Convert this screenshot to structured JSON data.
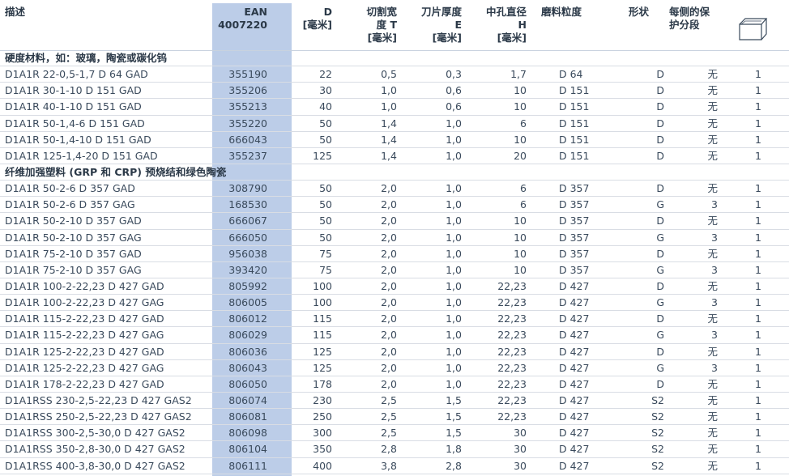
{
  "columns": {
    "desc": "描述",
    "ean": "EAN\n4007220",
    "d": "D\n[毫米]",
    "t": "切割宽\n度 T\n[毫米]",
    "e": "刀片厚度\nE\n[毫米]",
    "h": "中孔直径\nH\n[毫米]",
    "grit": "磨料粒度",
    "shape": "形状",
    "protect": "每侧的保\n护分段",
    "pack_icon": "box-icon"
  },
  "sections": [
    {
      "title": "硬度材料，如：玻璃，陶瓷或碳化钨",
      "rows": [
        {
          "desc": "D1A1R 22-0,5-1,7 D 64 GAD",
          "ean": "355190",
          "d": "22",
          "t": "0,5",
          "e": "0,3",
          "h": "1,7",
          "grit": "D 64",
          "shape": "D",
          "protect": "无",
          "pack": "1"
        },
        {
          "desc": "D1A1R 30-1-10 D 151 GAD",
          "ean": "355206",
          "d": "30",
          "t": "1,0",
          "e": "0,6",
          "h": "10",
          "grit": "D 151",
          "shape": "D",
          "protect": "无",
          "pack": "1"
        },
        {
          "desc": "D1A1R 40-1-10 D 151 GAD",
          "ean": "355213",
          "d": "40",
          "t": "1,0",
          "e": "0,6",
          "h": "10",
          "grit": "D 151",
          "shape": "D",
          "protect": "无",
          "pack": "1"
        },
        {
          "desc": "D1A1R 50-1,4-6 D 151 GAD",
          "ean": "355220",
          "d": "50",
          "t": "1,4",
          "e": "1,0",
          "h": "6",
          "grit": "D 151",
          "shape": "D",
          "protect": "无",
          "pack": "1"
        },
        {
          "desc": "D1A1R 50-1,4-10 D 151 GAD",
          "ean": "666043",
          "d": "50",
          "t": "1,4",
          "e": "1,0",
          "h": "10",
          "grit": "D 151",
          "shape": "D",
          "protect": "无",
          "pack": "1"
        },
        {
          "desc": "D1A1R 125-1,4-20 D 151 GAD",
          "ean": "355237",
          "d": "125",
          "t": "1,4",
          "e": "1,0",
          "h": "20",
          "grit": "D 151",
          "shape": "D",
          "protect": "无",
          "pack": "1"
        }
      ]
    },
    {
      "title": "纤维加强塑料 (GRP 和 CRP) 预烧结和绿色陶瓷",
      "rows": [
        {
          "desc": "D1A1R 50-2-6 D 357 GAD",
          "ean": "308790",
          "d": "50",
          "t": "2,0",
          "e": "1,0",
          "h": "6",
          "grit": "D 357",
          "shape": "D",
          "protect": "无",
          "pack": "1"
        },
        {
          "desc": "D1A1R 50-2-6 D 357 GAG",
          "ean": "168530",
          "d": "50",
          "t": "2,0",
          "e": "1,0",
          "h": "6",
          "grit": "D 357",
          "shape": "G",
          "protect": "3",
          "pack": "1"
        },
        {
          "desc": "D1A1R 50-2-10 D 357 GAD",
          "ean": "666067",
          "d": "50",
          "t": "2,0",
          "e": "1,0",
          "h": "10",
          "grit": "D 357",
          "shape": "D",
          "protect": "无",
          "pack": "1"
        },
        {
          "desc": "D1A1R 50-2-10 D 357 GAG",
          "ean": "666050",
          "d": "50",
          "t": "2,0",
          "e": "1,0",
          "h": "10",
          "grit": "D 357",
          "shape": "G",
          "protect": "3",
          "pack": "1"
        },
        {
          "desc": "D1A1R 75-2-10 D 357 GAD",
          "ean": "956038",
          "d": "75",
          "t": "2,0",
          "e": "1,0",
          "h": "10",
          "grit": "D 357",
          "shape": "D",
          "protect": "无",
          "pack": "1"
        },
        {
          "desc": "D1A1R 75-2-10 D 357 GAG",
          "ean": "393420",
          "d": "75",
          "t": "2,0",
          "e": "1,0",
          "h": "10",
          "grit": "D 357",
          "shape": "G",
          "protect": "3",
          "pack": "1"
        },
        {
          "desc": "D1A1R 100-2-22,23 D 427 GAD",
          "ean": "805992",
          "d": "100",
          "t": "2,0",
          "e": "1,0",
          "h": "22,23",
          "grit": "D 427",
          "shape": "D",
          "protect": "无",
          "pack": "1"
        },
        {
          "desc": "D1A1R 100-2-22,23 D 427 GAG",
          "ean": "806005",
          "d": "100",
          "t": "2,0",
          "e": "1,0",
          "h": "22,23",
          "grit": "D 427",
          "shape": "G",
          "protect": "3",
          "pack": "1"
        },
        {
          "desc": "D1A1R 115-2-22,23 D 427 GAD",
          "ean": "806012",
          "d": "115",
          "t": "2,0",
          "e": "1,0",
          "h": "22,23",
          "grit": "D 427",
          "shape": "D",
          "protect": "无",
          "pack": "1"
        },
        {
          "desc": "D1A1R 115-2-22,23 D 427 GAG",
          "ean": "806029",
          "d": "115",
          "t": "2,0",
          "e": "1,0",
          "h": "22,23",
          "grit": "D 427",
          "shape": "G",
          "protect": "3",
          "pack": "1"
        },
        {
          "desc": "D1A1R 125-2-22,23 D 427 GAD",
          "ean": "806036",
          "d": "125",
          "t": "2,0",
          "e": "1,0",
          "h": "22,23",
          "grit": "D 427",
          "shape": "D",
          "protect": "无",
          "pack": "1"
        },
        {
          "desc": "D1A1R 125-2-22,23 D 427 GAG",
          "ean": "806043",
          "d": "125",
          "t": "2,0",
          "e": "1,0",
          "h": "22,23",
          "grit": "D 427",
          "shape": "G",
          "protect": "3",
          "pack": "1"
        },
        {
          "desc": "D1A1R 178-2-22,23 D 427 GAD",
          "ean": "806050",
          "d": "178",
          "t": "2,0",
          "e": "1,0",
          "h": "22,23",
          "grit": "D 427",
          "shape": "D",
          "protect": "无",
          "pack": "1"
        },
        {
          "desc": "D1A1RSS 230-2,5-22,23 D 427 GAS2",
          "ean": "806074",
          "d": "230",
          "t": "2,5",
          "e": "1,5",
          "h": "22,23",
          "grit": "D 427",
          "shape": "S2",
          "protect": "无",
          "pack": "1"
        },
        {
          "desc": "D1A1RSS 250-2,5-22,23 D 427 GAS2",
          "ean": "806081",
          "d": "250",
          "t": "2,5",
          "e": "1,5",
          "h": "22,23",
          "grit": "D 427",
          "shape": "S2",
          "protect": "无",
          "pack": "1"
        },
        {
          "desc": "D1A1RSS 300-2,5-30,0 D 427 GAS2",
          "ean": "806098",
          "d": "300",
          "t": "2,5",
          "e": "1,5",
          "h": "30",
          "grit": "D 427",
          "shape": "S2",
          "protect": "无",
          "pack": "1"
        },
        {
          "desc": "D1A1RSS 350-2,8-30,0 D 427 GAS2",
          "ean": "806104",
          "d": "350",
          "t": "2,8",
          "e": "1,8",
          "h": "30",
          "grit": "D 427",
          "shape": "S2",
          "protect": "无",
          "pack": "1"
        },
        {
          "desc": "D1A1RSS 400-3,8-30,0 D 427 GAS2",
          "ean": "806111",
          "d": "400",
          "t": "3,8",
          "e": "2,8",
          "h": "30",
          "grit": "D 427",
          "shape": "S2",
          "protect": "无",
          "pack": "1"
        }
      ]
    }
  ]
}
